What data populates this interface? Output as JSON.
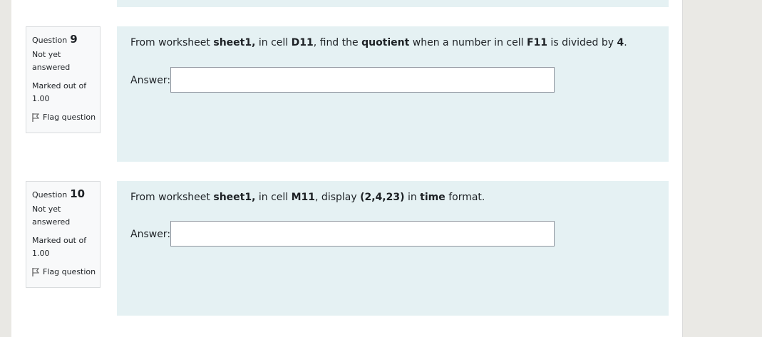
{
  "questions": [
    {
      "label": "Question",
      "number": "9",
      "state": "Not yet answered",
      "grade": "Marked out of 1.00",
      "flag_label": "Flag question",
      "text": {
        "p1": "From worksheet ",
        "b1": "sheet1,",
        "p2": " in cell ",
        "b2": "D11",
        "p3": ", find the ",
        "b3": "quotient",
        "p4": " when a number in cell ",
        "b4": "F11",
        "p5": " is divided by ",
        "b5": "4",
        "p6": "."
      },
      "answer_label": "Answer:",
      "answer_value": ""
    },
    {
      "label": "Question",
      "number": "10",
      "state": "Not yet answered",
      "grade": "Marked out of 1.00",
      "flag_label": "Flag question",
      "text": {
        "p1": "From worksheet ",
        "b1": "sheet1,",
        "p2": " in cell ",
        "b2": "M11",
        "p3": ", display ",
        "b3": "(2,4,23)",
        "p4": " in ",
        "b4": "time",
        "p5": " format."
      },
      "answer_label": "Answer:",
      "answer_value": ""
    }
  ],
  "icons": {
    "flag": "flag-icon"
  }
}
